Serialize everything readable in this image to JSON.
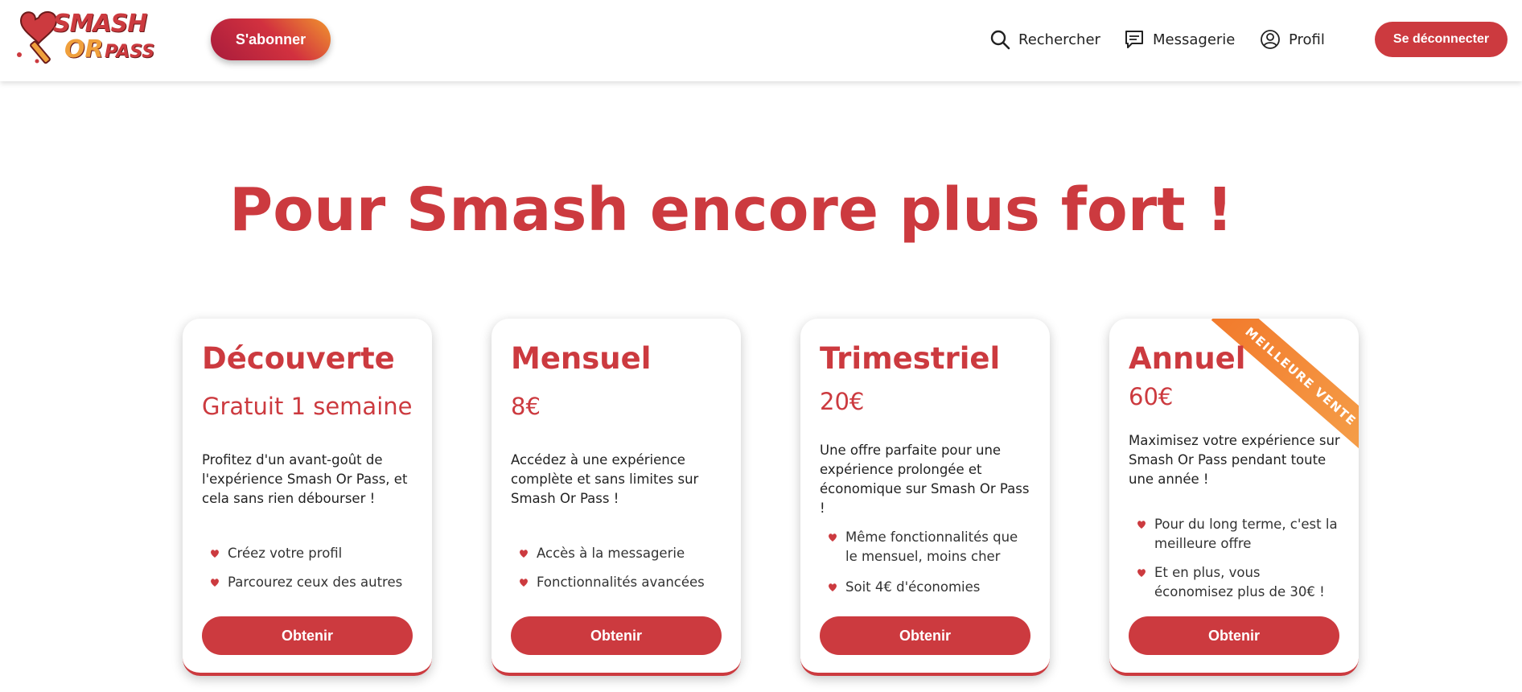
{
  "header": {
    "logo": {
      "line1": "SMASH",
      "or": "OR",
      "pass": "PASS"
    },
    "subscribe_label": "S'abonner",
    "nav": {
      "search_label": "Rechercher",
      "messages_label": "Messagerie",
      "profile_label": "Profil"
    },
    "logout_label": "Se déconnecter"
  },
  "hero": {
    "title": "Pour Smash encore plus fort !"
  },
  "plans": [
    {
      "title": "Découverte",
      "price": "Gratuit 1 semaine",
      "description": "Profitez d'un avant-goût de l'expérience Smash Or Pass, et cela sans rien débourser !",
      "features": [
        "Créez votre profil",
        "Parcourez ceux des autres"
      ],
      "button": "Obtenir"
    },
    {
      "title": "Mensuel",
      "price": "8€",
      "description": "Accédez à une expérience complète et sans limites sur Smash Or Pass !",
      "features": [
        "Accès à la messagerie",
        "Fonctionnalités avancées"
      ],
      "button": "Obtenir"
    },
    {
      "title": "Trimestriel",
      "price": "20€",
      "description": "Une offre parfaite pour une expérience prolongée et économique sur Smash Or Pass !",
      "features": [
        "Même fonctionnalités que le mensuel, moins cher",
        "Soit 4€ d'économies"
      ],
      "button": "Obtenir"
    },
    {
      "title": "Annuel",
      "price": "60€",
      "description": "Maximisez votre expérience sur Smash Or Pass pendant toute une année !",
      "features": [
        "Pour du long terme, c'est la meilleure offre",
        "Et en plus, vous économisez plus de 30€ !"
      ],
      "button": "Obtenir",
      "ribbon": "MEILLEURE VENTE"
    }
  ],
  "colors": {
    "primary": "#cc3a3f",
    "ribbon": "#f27a2c",
    "gradient_start": "#a81c3c",
    "gradient_end": "#f0952e"
  }
}
